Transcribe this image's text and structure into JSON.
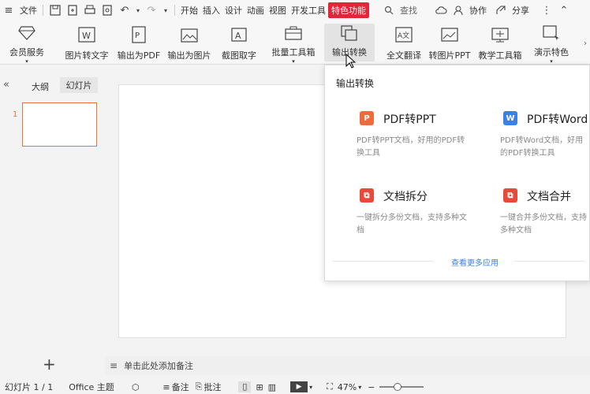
{
  "menubar": {
    "file": "文件",
    "tabs": [
      "开始",
      "插入",
      "设计",
      "动画",
      "视图",
      "开发工具"
    ],
    "special": "特色功能",
    "search": "查找",
    "collab": "协作",
    "share": "分享"
  },
  "ribbon": {
    "items": [
      {
        "label": "会员服务",
        "icon": "diamond-icon"
      },
      {
        "label": "图片转文字",
        "icon": "image-to-text-icon"
      },
      {
        "label": "输出为PDF",
        "icon": "pdf-export-icon"
      },
      {
        "label": "输出为图片",
        "icon": "image-export-icon"
      },
      {
        "label": "截图取字",
        "icon": "screenshot-text-icon"
      },
      {
        "label": "批量工具箱",
        "icon": "toolbox-icon"
      },
      {
        "label": "输出转换",
        "icon": "convert-icon"
      },
      {
        "label": "全文翻译",
        "icon": "translate-icon"
      },
      {
        "label": "转图片PPT",
        "icon": "image-ppt-icon"
      },
      {
        "label": "教学工具箱",
        "icon": "teaching-icon"
      },
      {
        "label": "演示特色",
        "icon": "present-icon"
      }
    ]
  },
  "leftpanel": {
    "tab_outline": "大纲",
    "tab_slides": "幻灯片",
    "slide_number": "1"
  },
  "dropdown": {
    "header": "输出转换",
    "cards": [
      {
        "title": "PDF转PPT",
        "desc": "PDF转PPT文档，好用的PDF转换工具",
        "icon_color": "#ee6b3c"
      },
      {
        "title": "PDF转Word",
        "desc": "PDF转Word文档，好用的PDF转换工具",
        "icon_color": "#3b7fe8"
      },
      {
        "title": "文档拆分",
        "desc": "一键拆分多份文档，支持多种文档",
        "icon_color": "#e8493b"
      },
      {
        "title": "文档合并",
        "desc": "一键合并多份文档，支持多种文档",
        "icon_color": "#e8493b"
      }
    ],
    "more": "查看更多应用"
  },
  "notes": {
    "placeholder": "单击此处添加备注"
  },
  "status": {
    "slide_info": "幻灯片 1 / 1",
    "theme": "Office 主题",
    "notes": "备注",
    "comments": "批注",
    "zoom": "47%"
  },
  "colors": {
    "accent": "#e2263a",
    "link": "#3b7fe8",
    "slide_border": "#e8743b"
  }
}
